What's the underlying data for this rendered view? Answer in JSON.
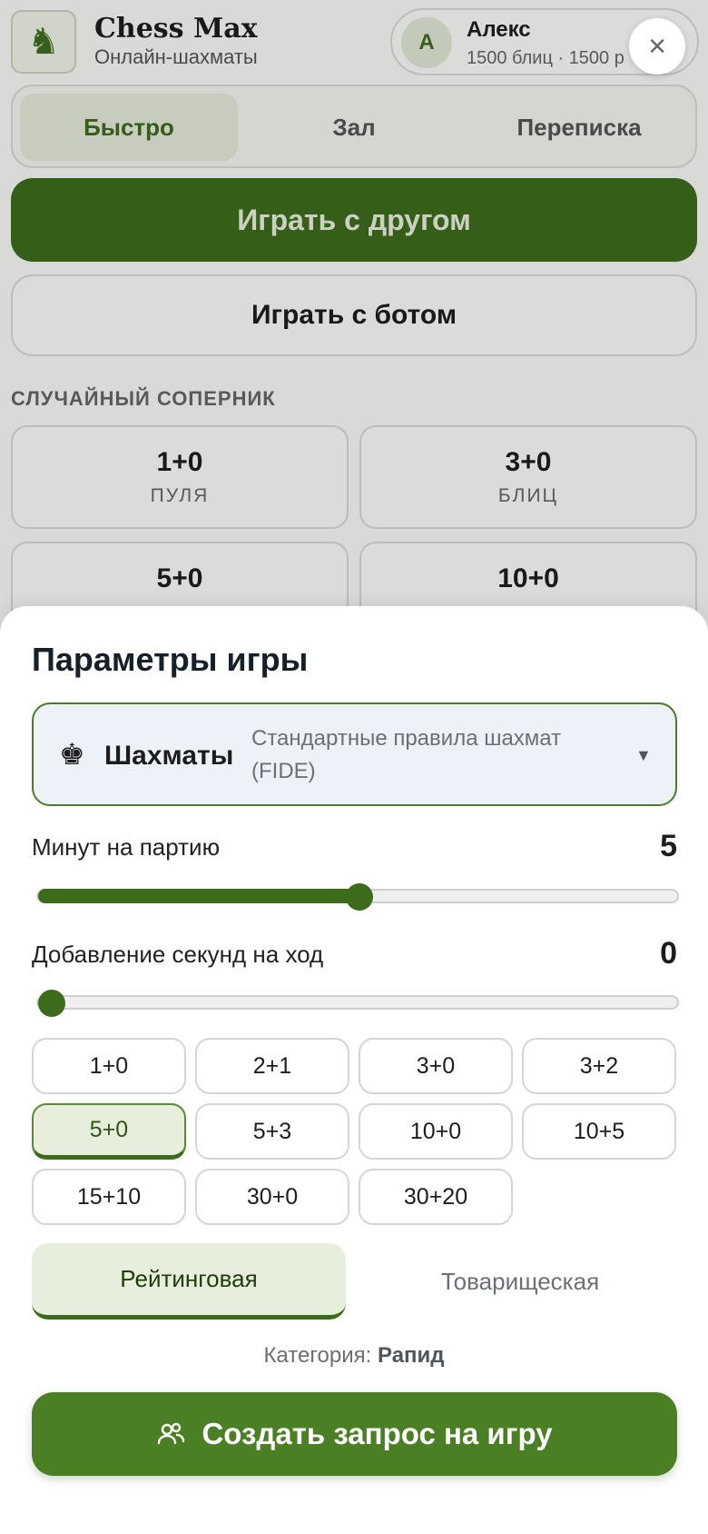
{
  "header": {
    "brand_title": "Chess Max",
    "brand_subtitle": "Онлайн-шахматы",
    "logo_icon": "♞",
    "user": {
      "initial": "А",
      "name": "Алекс",
      "rating": "1500 блиц · 1500 р"
    }
  },
  "tabs": [
    {
      "label": "Быстро",
      "active": true
    },
    {
      "label": "Зал",
      "active": false
    },
    {
      "label": "Переписка",
      "active": false
    }
  ],
  "actions": {
    "play_friend": "Играть с другом",
    "play_bot": "Играть с ботом"
  },
  "random_opponent": {
    "label": "СЛУЧАЙНЫЙ СОПЕРНИК",
    "cards": [
      {
        "value": "1+0",
        "name": "ПУЛЯ"
      },
      {
        "value": "3+0",
        "name": "БЛИЦ"
      },
      {
        "value": "5+0",
        "name": ""
      },
      {
        "value": "10+0",
        "name": ""
      }
    ]
  },
  "close_icon": "×",
  "sheet": {
    "title": "Параметры игры",
    "variant": {
      "icon": "♚",
      "name": "Шахматы",
      "description": "Стандартные правила шахмат (FIDE)",
      "caret": "▼"
    },
    "minutes": {
      "label": "Минут на партию",
      "value": "5",
      "fraction": 0.5
    },
    "increment": {
      "label": "Добавление секунд на ход",
      "value": "0",
      "fraction": 0.0
    },
    "presets": [
      {
        "label": "1+0",
        "selected": false
      },
      {
        "label": "2+1",
        "selected": false
      },
      {
        "label": "3+0",
        "selected": false
      },
      {
        "label": "3+2",
        "selected": false
      },
      {
        "label": "5+0",
        "selected": true
      },
      {
        "label": "5+3",
        "selected": false
      },
      {
        "label": "10+0",
        "selected": false
      },
      {
        "label": "10+5",
        "selected": false
      },
      {
        "label": "15+10",
        "selected": false
      },
      {
        "label": "30+0",
        "selected": false
      },
      {
        "label": "30+20",
        "selected": false
      }
    ],
    "modes": {
      "rated": "Рейтинговая",
      "casual": "Товарищеская",
      "selected": "rated"
    },
    "category": {
      "label": "Категория:",
      "value": "Рапид"
    },
    "create_button": "Создать запрос на игру"
  },
  "colors": {
    "accent": "#3d6b1c",
    "accent_light": "#e7efdc",
    "variant_bg": "#edf1f8"
  }
}
